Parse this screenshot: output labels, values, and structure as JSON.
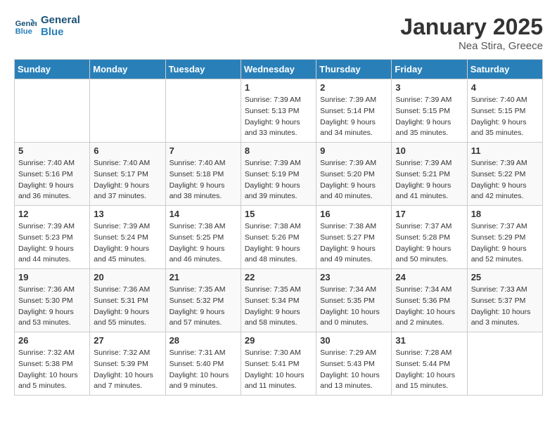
{
  "logo": {
    "line1": "General",
    "line2": "Blue"
  },
  "title": "January 2025",
  "subtitle": "Nea Stira, Greece",
  "headers": [
    "Sunday",
    "Monday",
    "Tuesday",
    "Wednesday",
    "Thursday",
    "Friday",
    "Saturday"
  ],
  "weeks": [
    [
      {
        "day": "",
        "sunrise": "",
        "sunset": "",
        "daylight": ""
      },
      {
        "day": "",
        "sunrise": "",
        "sunset": "",
        "daylight": ""
      },
      {
        "day": "",
        "sunrise": "",
        "sunset": "",
        "daylight": ""
      },
      {
        "day": "1",
        "sunrise": "Sunrise: 7:39 AM",
        "sunset": "Sunset: 5:13 PM",
        "daylight": "Daylight: 9 hours and 33 minutes."
      },
      {
        "day": "2",
        "sunrise": "Sunrise: 7:39 AM",
        "sunset": "Sunset: 5:14 PM",
        "daylight": "Daylight: 9 hours and 34 minutes."
      },
      {
        "day": "3",
        "sunrise": "Sunrise: 7:39 AM",
        "sunset": "Sunset: 5:15 PM",
        "daylight": "Daylight: 9 hours and 35 minutes."
      },
      {
        "day": "4",
        "sunrise": "Sunrise: 7:40 AM",
        "sunset": "Sunset: 5:15 PM",
        "daylight": "Daylight: 9 hours and 35 minutes."
      }
    ],
    [
      {
        "day": "5",
        "sunrise": "Sunrise: 7:40 AM",
        "sunset": "Sunset: 5:16 PM",
        "daylight": "Daylight: 9 hours and 36 minutes."
      },
      {
        "day": "6",
        "sunrise": "Sunrise: 7:40 AM",
        "sunset": "Sunset: 5:17 PM",
        "daylight": "Daylight: 9 hours and 37 minutes."
      },
      {
        "day": "7",
        "sunrise": "Sunrise: 7:40 AM",
        "sunset": "Sunset: 5:18 PM",
        "daylight": "Daylight: 9 hours and 38 minutes."
      },
      {
        "day": "8",
        "sunrise": "Sunrise: 7:39 AM",
        "sunset": "Sunset: 5:19 PM",
        "daylight": "Daylight: 9 hours and 39 minutes."
      },
      {
        "day": "9",
        "sunrise": "Sunrise: 7:39 AM",
        "sunset": "Sunset: 5:20 PM",
        "daylight": "Daylight: 9 hours and 40 minutes."
      },
      {
        "day": "10",
        "sunrise": "Sunrise: 7:39 AM",
        "sunset": "Sunset: 5:21 PM",
        "daylight": "Daylight: 9 hours and 41 minutes."
      },
      {
        "day": "11",
        "sunrise": "Sunrise: 7:39 AM",
        "sunset": "Sunset: 5:22 PM",
        "daylight": "Daylight: 9 hours and 42 minutes."
      }
    ],
    [
      {
        "day": "12",
        "sunrise": "Sunrise: 7:39 AM",
        "sunset": "Sunset: 5:23 PM",
        "daylight": "Daylight: 9 hours and 44 minutes."
      },
      {
        "day": "13",
        "sunrise": "Sunrise: 7:39 AM",
        "sunset": "Sunset: 5:24 PM",
        "daylight": "Daylight: 9 hours and 45 minutes."
      },
      {
        "day": "14",
        "sunrise": "Sunrise: 7:38 AM",
        "sunset": "Sunset: 5:25 PM",
        "daylight": "Daylight: 9 hours and 46 minutes."
      },
      {
        "day": "15",
        "sunrise": "Sunrise: 7:38 AM",
        "sunset": "Sunset: 5:26 PM",
        "daylight": "Daylight: 9 hours and 48 minutes."
      },
      {
        "day": "16",
        "sunrise": "Sunrise: 7:38 AM",
        "sunset": "Sunset: 5:27 PM",
        "daylight": "Daylight: 9 hours and 49 minutes."
      },
      {
        "day": "17",
        "sunrise": "Sunrise: 7:37 AM",
        "sunset": "Sunset: 5:28 PM",
        "daylight": "Daylight: 9 hours and 50 minutes."
      },
      {
        "day": "18",
        "sunrise": "Sunrise: 7:37 AM",
        "sunset": "Sunset: 5:29 PM",
        "daylight": "Daylight: 9 hours and 52 minutes."
      }
    ],
    [
      {
        "day": "19",
        "sunrise": "Sunrise: 7:36 AM",
        "sunset": "Sunset: 5:30 PM",
        "daylight": "Daylight: 9 hours and 53 minutes."
      },
      {
        "day": "20",
        "sunrise": "Sunrise: 7:36 AM",
        "sunset": "Sunset: 5:31 PM",
        "daylight": "Daylight: 9 hours and 55 minutes."
      },
      {
        "day": "21",
        "sunrise": "Sunrise: 7:35 AM",
        "sunset": "Sunset: 5:32 PM",
        "daylight": "Daylight: 9 hours and 57 minutes."
      },
      {
        "day": "22",
        "sunrise": "Sunrise: 7:35 AM",
        "sunset": "Sunset: 5:34 PM",
        "daylight": "Daylight: 9 hours and 58 minutes."
      },
      {
        "day": "23",
        "sunrise": "Sunrise: 7:34 AM",
        "sunset": "Sunset: 5:35 PM",
        "daylight": "Daylight: 10 hours and 0 minutes."
      },
      {
        "day": "24",
        "sunrise": "Sunrise: 7:34 AM",
        "sunset": "Sunset: 5:36 PM",
        "daylight": "Daylight: 10 hours and 2 minutes."
      },
      {
        "day": "25",
        "sunrise": "Sunrise: 7:33 AM",
        "sunset": "Sunset: 5:37 PM",
        "daylight": "Daylight: 10 hours and 3 minutes."
      }
    ],
    [
      {
        "day": "26",
        "sunrise": "Sunrise: 7:32 AM",
        "sunset": "Sunset: 5:38 PM",
        "daylight": "Daylight: 10 hours and 5 minutes."
      },
      {
        "day": "27",
        "sunrise": "Sunrise: 7:32 AM",
        "sunset": "Sunset: 5:39 PM",
        "daylight": "Daylight: 10 hours and 7 minutes."
      },
      {
        "day": "28",
        "sunrise": "Sunrise: 7:31 AM",
        "sunset": "Sunset: 5:40 PM",
        "daylight": "Daylight: 10 hours and 9 minutes."
      },
      {
        "day": "29",
        "sunrise": "Sunrise: 7:30 AM",
        "sunset": "Sunset: 5:41 PM",
        "daylight": "Daylight: 10 hours and 11 minutes."
      },
      {
        "day": "30",
        "sunrise": "Sunrise: 7:29 AM",
        "sunset": "Sunset: 5:43 PM",
        "daylight": "Daylight: 10 hours and 13 minutes."
      },
      {
        "day": "31",
        "sunrise": "Sunrise: 7:28 AM",
        "sunset": "Sunset: 5:44 PM",
        "daylight": "Daylight: 10 hours and 15 minutes."
      },
      {
        "day": "",
        "sunrise": "",
        "sunset": "",
        "daylight": ""
      }
    ]
  ]
}
